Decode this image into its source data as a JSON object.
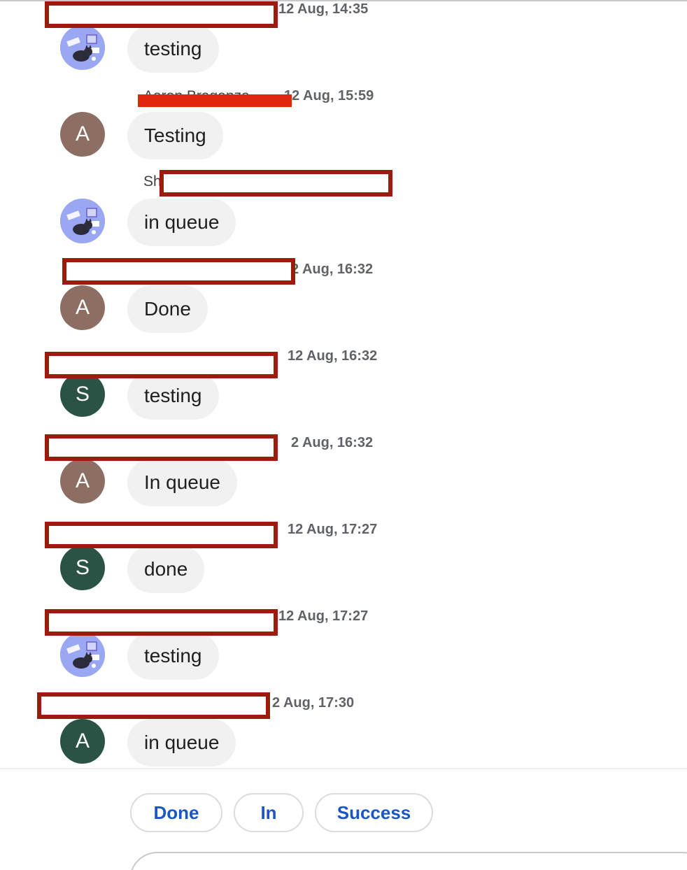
{
  "messages": [
    {
      "sender": "",
      "time": "12 Aug, 14:35",
      "avatar_type": "image",
      "avatar_letter": "",
      "text": "testing"
    },
    {
      "sender": "Aaron Braganza",
      "time": "12 Aug, 15:59",
      "avatar_type": "brown",
      "avatar_letter": "A",
      "text": "Testing"
    },
    {
      "sender": "Sh",
      "time": "",
      "avatar_type": "image",
      "avatar_letter": "",
      "text": "in queue"
    },
    {
      "sender": "",
      "time": "2 Aug, 16:32",
      "avatar_type": "brown",
      "avatar_letter": "A",
      "text": "Done"
    },
    {
      "sender": "",
      "time": "12 Aug, 16:32",
      "avatar_type": "green",
      "avatar_letter": "S",
      "text": "testing"
    },
    {
      "sender": "",
      "time": "2 Aug, 16:32",
      "avatar_type": "brown",
      "avatar_letter": "A",
      "text": "In queue"
    },
    {
      "sender": "",
      "time": "12 Aug, 17:27",
      "avatar_type": "green",
      "avatar_letter": "S",
      "text": "done"
    },
    {
      "sender": "",
      "time": "12 Aug, 17:27",
      "avatar_type": "image",
      "avatar_letter": "",
      "text": "testing"
    },
    {
      "sender": "",
      "time": "2 Aug, 17:30",
      "avatar_type": "green",
      "avatar_letter": "A",
      "text": "in queue"
    }
  ],
  "suggestions": [
    "Done",
    "In",
    "Success"
  ],
  "colors": {
    "chip_text": "#1a56c9",
    "bubble_bg": "#f1f1f1",
    "redaction_border": "#9b1c0c",
    "avatar_brown": "#8d6e63",
    "avatar_green": "#2b5345"
  },
  "icons": {
    "bot_avatar": "cat-at-desk-illustration-icon"
  }
}
